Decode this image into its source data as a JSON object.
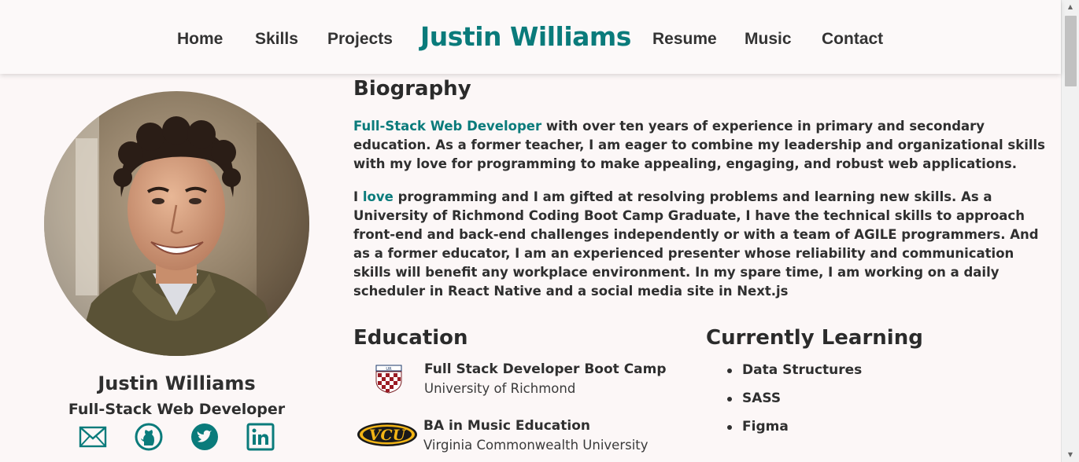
{
  "nav": {
    "left": [
      "Home",
      "Skills",
      "Projects"
    ],
    "brand": "Justin Williams",
    "right": [
      "Resume",
      "Music",
      "Contact"
    ]
  },
  "profile": {
    "name": "Justin Williams",
    "title": "Full-Stack Web Developer",
    "socials": [
      "mail-icon",
      "github-icon",
      "twitter-icon",
      "linkedin-icon"
    ]
  },
  "biography": {
    "heading": "Biography",
    "p1_highlight": "Full-Stack Web Developer",
    "p1_rest": " with over ten years of experience in primary and secondary education. As a former teacher, I am eager to combine my leadership and organizational skills with my love for programming to make appealing, engaging, and robust web applications.",
    "p2_start": "I ",
    "p2_highlight": "love",
    "p2_rest": " programming and I am gifted at resolving problems and learning new skills. As a University of Richmond Coding Boot Camp Graduate, I have the technical skills to approach front-end and back-end challenges independently or with a team of AGILE programmers. And as a former educator, I am an experienced presenter whose reliability and communication skills will benefit any workplace environment. In my spare time, I am working on a daily scheduler in React Native and a social media site in Next.js"
  },
  "education": {
    "heading": "Education",
    "items": [
      {
        "degree": "Full Stack Developer Boot Camp",
        "school": "University of Richmond",
        "logo": "university-of-richmond-logo"
      },
      {
        "degree": "BA in Music Education",
        "school": "Virginia Commonwealth University",
        "logo": "vcu-logo",
        "logo_text": "VCU"
      }
    ]
  },
  "learning": {
    "heading": "Currently Learning",
    "items": [
      "Data Structures",
      "SASS",
      "Figma"
    ]
  },
  "colors": {
    "accent": "#0a7b7b",
    "background": "#fcf7f7",
    "text": "#2f2f2f"
  }
}
